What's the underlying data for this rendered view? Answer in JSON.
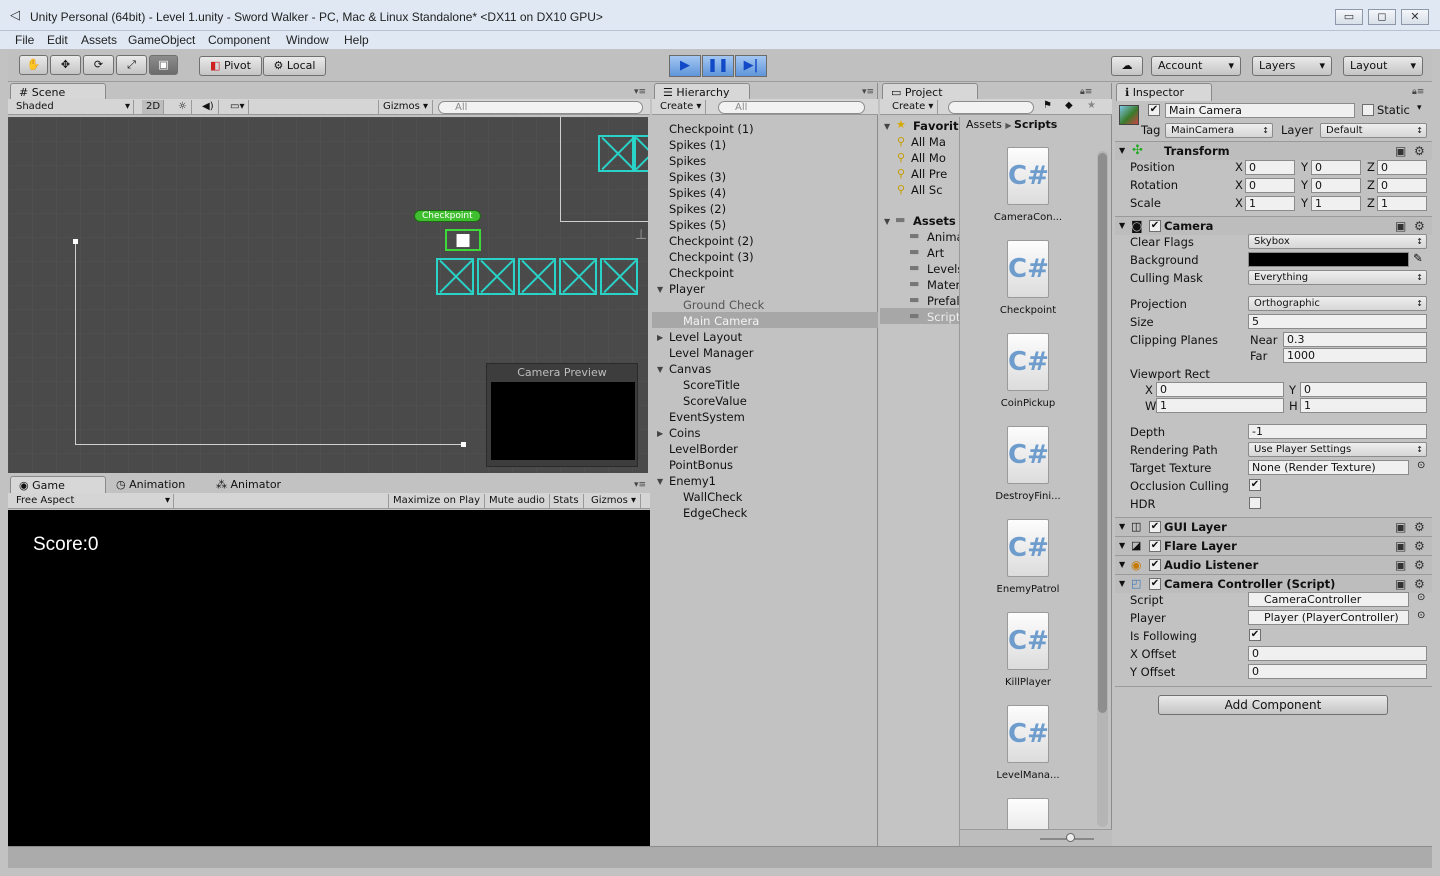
{
  "window": {
    "title": "Unity Personal (64bit) - Level 1.unity - Sword Walker - PC, Mac & Linux Standalone* <DX11 on DX10 GPU>",
    "minimize": "▭",
    "restore": "◻",
    "close": "✕"
  },
  "menu": [
    "File",
    "Edit",
    "Assets",
    "GameObject",
    "Component",
    "Window",
    "Help"
  ],
  "toolbar": {
    "pivot": "Pivot",
    "local": "Local",
    "account": "Account",
    "layers": "Layers",
    "layout": "Layout"
  },
  "scene": {
    "tab": "Scene",
    "shading": "Shaded",
    "mode2d": "2D",
    "gizmos": "Gizmos",
    "search_placeholder": "All",
    "checkpoint_label": "Checkpoint",
    "camera_preview": "Camera Preview"
  },
  "game": {
    "tabs": [
      "Game",
      "Animation",
      "Animator"
    ],
    "aspect": "Free Aspect",
    "maximize": "Maximize on Play",
    "mute": "Mute audio",
    "stats": "Stats",
    "gizmos": "Gizmos",
    "score": "Score:0"
  },
  "hierarchy": {
    "tab": "Hierarchy",
    "create": "Create",
    "search_placeholder": "All",
    "items": [
      "Checkpoint (1)",
      "Spikes (1)",
      "Spikes",
      "Spikes (3)",
      "Spikes (4)",
      "Spikes (2)",
      "Spikes (5)",
      "Checkpoint (2)",
      "Checkpoint (3)",
      "Checkpoint",
      "Player",
      "Ground Check",
      "Main Camera",
      "Level Layout",
      "Level Manager",
      "Canvas",
      "ScoreTitle",
      "ScoreValue",
      "EventSystem",
      "Coins",
      "LevelBorder",
      "PointBonus",
      "Enemy1",
      "WallCheck",
      "EdgeCheck"
    ]
  },
  "project": {
    "tab": "Project",
    "create": "Create",
    "favorites": "Favorit",
    "fav_items": [
      "All Ma",
      "All Mo",
      "All Pre",
      "All Sc"
    ],
    "assets": "Assets",
    "folders": [
      "Anima",
      "Art",
      "Levels",
      "Mater",
      "Prefal",
      "Script"
    ],
    "breadcrumb": [
      "Assets",
      "Scripts"
    ],
    "files": [
      "CameraCon...",
      "Checkpoint",
      "CoinPickup",
      "DestroyFini...",
      "EnemyPatrol",
      "KillPlayer",
      "LevelMana..."
    ],
    "cs_glyph": "C#"
  },
  "inspector": {
    "tab": "Inspector",
    "name": "Main Camera",
    "static": "Static",
    "tag_label": "Tag",
    "tag": "MainCamera",
    "layer_label": "Layer",
    "layer": "Default",
    "transform": {
      "title": "Transform",
      "rows": [
        {
          "label": "Position",
          "x": "0",
          "y": "0",
          "z": "0"
        },
        {
          "label": "Rotation",
          "x": "0",
          "y": "0",
          "z": "0"
        },
        {
          "label": "Scale",
          "x": "1",
          "y": "1",
          "z": "1"
        }
      ]
    },
    "camera": {
      "title": "Camera",
      "clear_flags_label": "Clear Flags",
      "clear_flags": "Skybox",
      "background_label": "Background",
      "culling_label": "Culling Mask",
      "culling": "Everything",
      "projection_label": "Projection",
      "projection": "Orthographic",
      "size_label": "Size",
      "size": "5",
      "clipping_label": "Clipping Planes",
      "near_label": "Near",
      "near": "0.3",
      "far_label": "Far",
      "far": "1000",
      "viewport_label": "Viewport Rect",
      "vx": "0",
      "vy": "0",
      "vw": "1",
      "vh": "1",
      "depth_label": "Depth",
      "depth": "-1",
      "rendering_label": "Rendering Path",
      "rendering": "Use Player Settings",
      "target_label": "Target Texture",
      "target": "None (Render Texture)",
      "occlusion_label": "Occlusion Culling",
      "hdr_label": "HDR"
    },
    "gui_layer": "GUI Layer",
    "flare_layer": "Flare Layer",
    "audio_listener": "Audio Listener",
    "controller": {
      "title": "Camera Controller (Script)",
      "script_label": "Script",
      "script": "CameraController",
      "player_label": "Player",
      "player": "Player (PlayerController)",
      "following_label": "Is Following",
      "xoff_label": "X Offset",
      "xoff": "0",
      "yoff_label": "Y Offset",
      "yoff": "0"
    },
    "add_component": "Add Component"
  },
  "colors": {
    "accent": "#29d3c8",
    "selection": "#a7a7a7",
    "play_blue": "#5f95d9"
  }
}
